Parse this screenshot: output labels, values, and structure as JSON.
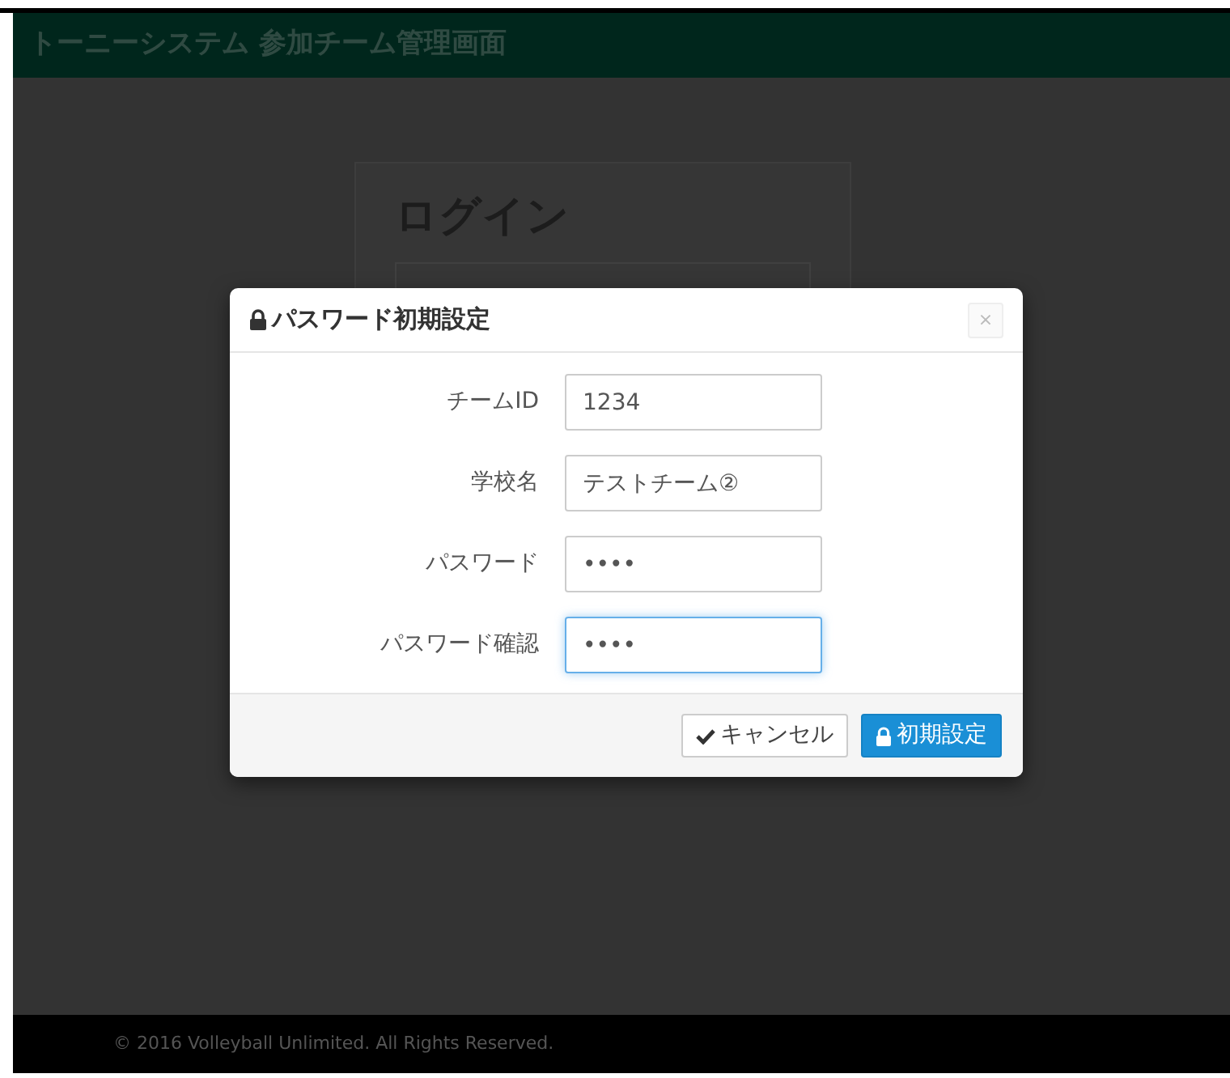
{
  "navbar": {
    "title": "トーニーシステム 参加チーム管理画面"
  },
  "login": {
    "title": "ログイン"
  },
  "dialog": {
    "title": "パスワード初期設定",
    "close": "×",
    "fields": [
      {
        "label": "チームID",
        "value": "1234",
        "focused": false
      },
      {
        "label": "学校名",
        "value": "テストチーム②",
        "focused": false
      },
      {
        "label": "パスワード",
        "value": "••••",
        "focused": false
      },
      {
        "label": "パスワード確認",
        "value": "••••",
        "focused": true
      }
    ],
    "buttons": [
      {
        "kind": "cancel",
        "label": "キャンセル"
      },
      {
        "kind": "primary",
        "label": "初期設定"
      }
    ]
  },
  "footer": {
    "text": "© 2016 Volleyball Unlimited. All Rights Reserved."
  }
}
